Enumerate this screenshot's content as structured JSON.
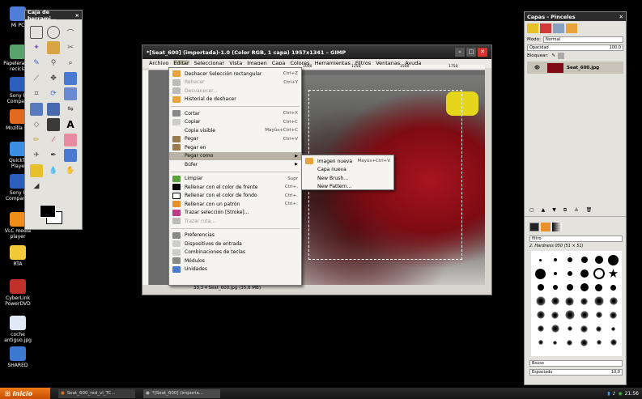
{
  "desktop_icons": [
    {
      "label": "Mi PC",
      "color": "#4f7ed8"
    },
    {
      "label": "Papelera de recicla",
      "color": "#58a36d"
    },
    {
      "label": "Sony P Compani",
      "color": "#2b5fbf"
    },
    {
      "label": "Mozilla Fir",
      "color": "#e06a1e"
    },
    {
      "label": "QuickTi Playe",
      "color": "#3b8fe0"
    },
    {
      "label": "Sony P Companio",
      "color": "#2b5fbf"
    },
    {
      "label": "VLC media player",
      "color": "#f08c1a"
    },
    {
      "label": "RTA",
      "color": "#f2c93a"
    },
    {
      "label": "CyberLink PowerDVD",
      "color": "#c0302a"
    },
    {
      "label": "coche antiguo.jpg",
      "color": "#dfe8f5"
    },
    {
      "label": "SHARED",
      "color": "#3b79d0"
    }
  ],
  "toolbox": {
    "title": "Caja de herrami...",
    "close": "×"
  },
  "gimp": {
    "title": "*[Seat_600] (importada)-1.0 (Color RGB, 1 capa) 1957x1341 – GIMP",
    "menus": [
      "Archivo",
      "Editar",
      "Seleccionar",
      "Vista",
      "Imagen",
      "Capa",
      "Colores",
      "Herramientas",
      "Filtros",
      "Ventanas",
      "Ayuda"
    ],
    "ruler_marks": [
      "1000",
      "1250",
      "1500",
      "1750"
    ],
    "status": "33,3 ▾ Seat_600.jpg (35,6 MB)"
  },
  "edit_menu": [
    {
      "label": "Deshacer Selección rectangular",
      "shortcut": "Ctrl+Z",
      "icon": "undo-icon",
      "color": "#e8a33a"
    },
    {
      "label": "Rehacer",
      "shortcut": "Ctrl+Y",
      "icon": "redo-icon",
      "color": "#bbb",
      "disabled": true
    },
    {
      "label": "Desvanecer...",
      "shortcut": "",
      "icon": "fade-icon",
      "color": "#bbb",
      "disabled": true
    },
    {
      "label": "Historial de deshacer",
      "shortcut": "",
      "icon": "history-icon",
      "color": "#e8a33a"
    },
    {
      "sep": true
    },
    {
      "label": "Cortar",
      "shortcut": "Ctrl+X",
      "icon": "cut-icon",
      "color": "#888"
    },
    {
      "label": "Copiar",
      "shortcut": "Ctrl+C",
      "icon": "copy-icon",
      "color": "#ccc"
    },
    {
      "label": "Copia visible",
      "shortcut": "Mayús+Ctrl+C",
      "icon": "copy-visible-icon",
      "color": "transparent"
    },
    {
      "label": "Pegar",
      "shortcut": "Ctrl+V",
      "icon": "paste-icon",
      "color": "#9a7b4e"
    },
    {
      "label": "Pegar en",
      "shortcut": "",
      "icon": "paste-into-icon",
      "color": "#9a7b4e"
    },
    {
      "label": "Pegar como",
      "shortcut": "",
      "icon": "paste-as-icon",
      "color": "transparent",
      "submenu": true,
      "highlight": true
    },
    {
      "label": "Búfer",
      "shortcut": "",
      "icon": "buffer-icon",
      "color": "transparent",
      "submenu": true
    },
    {
      "sep": true
    },
    {
      "label": "Limpiar",
      "shortcut": "Supr",
      "icon": "clear-icon",
      "color": "#5aa33a"
    },
    {
      "label": "Rellenar con el color de frente",
      "shortcut": "Ctrl+,",
      "icon": "fill-fg-icon",
      "color": "#000"
    },
    {
      "label": "Rellenar con el color de fondo",
      "shortcut": "Ctrl+.",
      "icon": "fill-bg-icon",
      "color": "#fff"
    },
    {
      "label": "Rellenar con un patrón",
      "shortcut": "Ctrl+;",
      "icon": "fill-pattern-icon",
      "color": "#e8902a"
    },
    {
      "label": "Trazar selección [Stroke]...",
      "shortcut": "",
      "icon": "stroke-selection-icon",
      "color": "#c03a8a"
    },
    {
      "label": "Trazar ruta...",
      "shortcut": "",
      "icon": "stroke-path-icon",
      "color": "#bbb",
      "disabled": true
    },
    {
      "sep": true
    },
    {
      "label": "Preferencias",
      "shortcut": "",
      "icon": "preferences-icon",
      "color": "#888"
    },
    {
      "label": "Dispositivos de entrada",
      "shortcut": "",
      "icon": "input-devices-icon",
      "color": "#ccc"
    },
    {
      "label": "Combinaciones de teclas",
      "shortcut": "",
      "icon": "keyboard-shortcuts-icon",
      "color": "#ccc"
    },
    {
      "label": "Módulos",
      "shortcut": "",
      "icon": "modules-icon",
      "color": "#888"
    },
    {
      "label": "Unidades",
      "shortcut": "",
      "icon": "units-icon",
      "color": "#4a7ad0"
    }
  ],
  "paste_as_submenu": [
    {
      "label": "Imagen nueva",
      "shortcut": "Mayús+Ctrl+V",
      "icon": "new-image-icon",
      "color": "#e8a33a",
      "highlight": false
    },
    {
      "label": "Capa nueva",
      "shortcut": "",
      "icon": "",
      "color": "transparent"
    },
    {
      "label": "New Brush...",
      "shortcut": "",
      "icon": "",
      "color": "transparent"
    },
    {
      "label": "New Pattern...",
      "shortcut": "",
      "icon": "",
      "color": "transparent"
    }
  ],
  "layers_panel": {
    "title": "Capas - Pinceles",
    "mode_label": "Modo:",
    "mode_value": "Normal",
    "opacity_label": "Opacidad",
    "opacity_value": "100,0",
    "lock_label": "Bloquear:",
    "layer_name": "Seat_600.jpg",
    "brush_filter": "filtro",
    "brush_name": "2. Hardness 050 (51 × 51)",
    "brush_mode": "Bsuso",
    "spacing_label": "Espaciado",
    "spacing_value": "10,0"
  },
  "taskbar": {
    "start": "Inicio",
    "tasks": [
      "Seat_600_red_vl_TC...",
      "*[Seat_600] (importa..."
    ],
    "clock": "21:56"
  }
}
